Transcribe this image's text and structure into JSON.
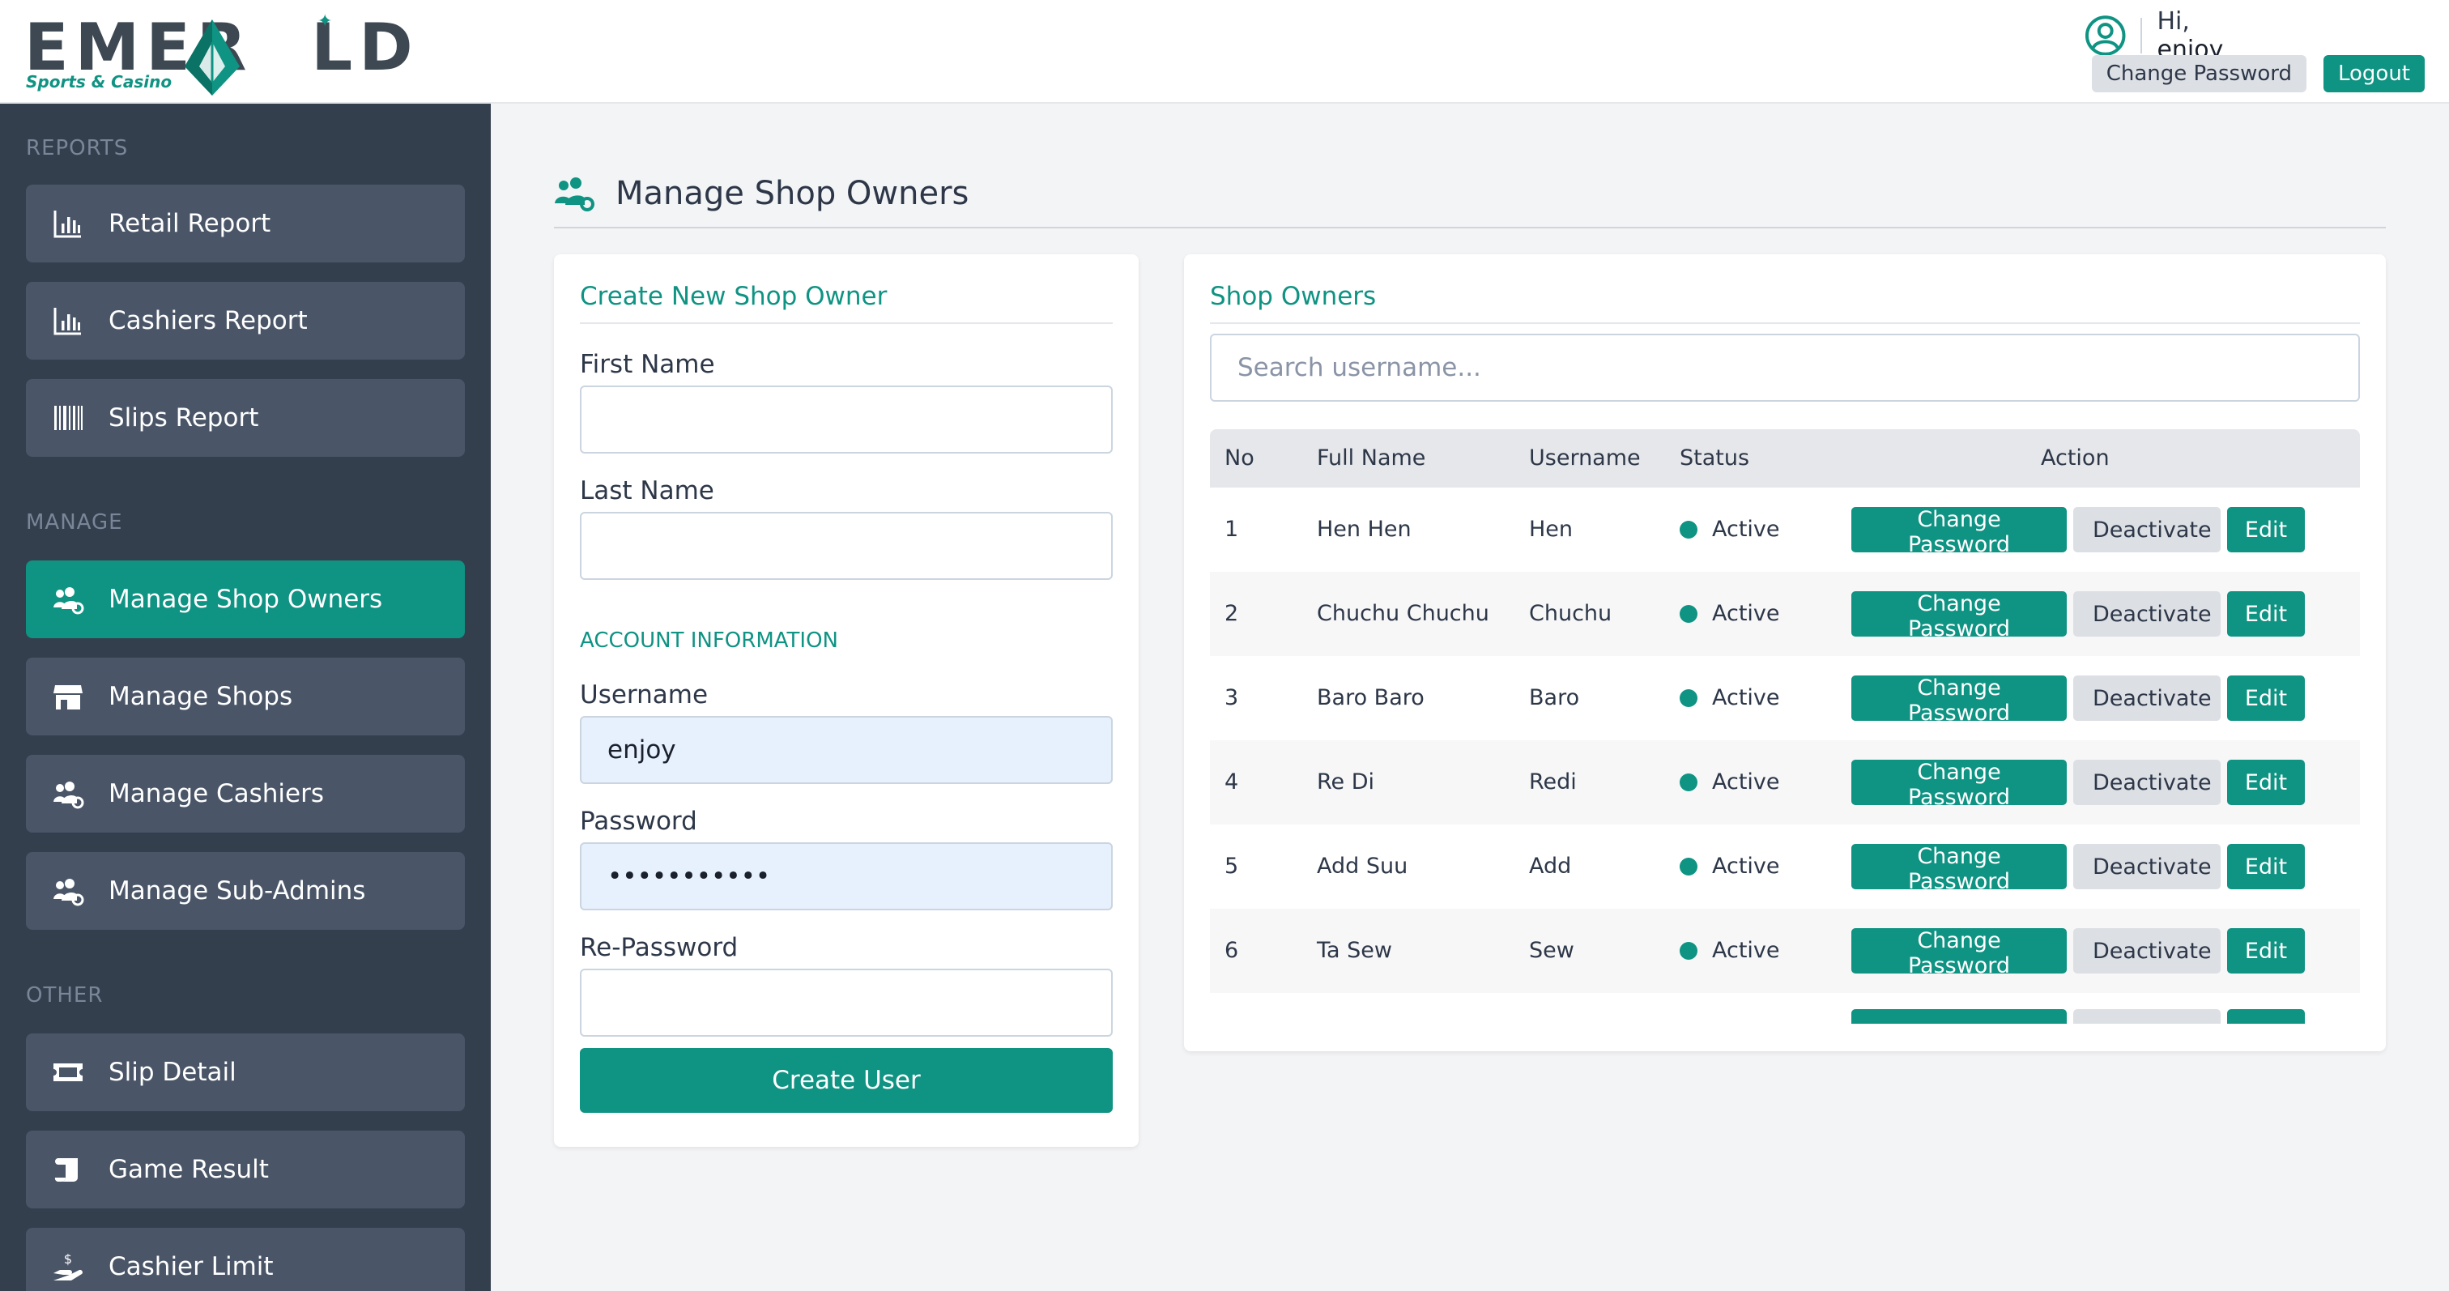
{
  "brand": {
    "name": "EMERALD",
    "tagline": "Sports & Casino",
    "accent": "#0f9383"
  },
  "header": {
    "greeting_prefix": "Hi,",
    "username": "enjoy",
    "change_password_label": "Change Password",
    "logout_label": "Logout"
  },
  "sidebar": {
    "sections": [
      {
        "title": "REPORTS",
        "items": [
          {
            "label": "Retail Report",
            "icon": "bar-chart-icon"
          },
          {
            "label": "Cashiers Report",
            "icon": "bar-chart-icon"
          },
          {
            "label": "Slips Report",
            "icon": "barcode-icon"
          }
        ]
      },
      {
        "title": "MANAGE",
        "items": [
          {
            "label": "Manage Shop Owners",
            "icon": "users-cog-icon",
            "active": true
          },
          {
            "label": "Manage Shops",
            "icon": "store-icon"
          },
          {
            "label": "Manage Cashiers",
            "icon": "users-cog-icon"
          },
          {
            "label": "Manage Sub-Admins",
            "icon": "users-cog-icon"
          }
        ]
      },
      {
        "title": "OTHER",
        "items": [
          {
            "label": "Slip Detail",
            "icon": "ticket-icon"
          },
          {
            "label": "Game Result",
            "icon": "scroll-icon"
          },
          {
            "label": "Cashier Limit",
            "icon": "hand-dollar-icon"
          }
        ]
      }
    ]
  },
  "page": {
    "title": "Manage Shop Owners"
  },
  "create_form": {
    "title": "Create New Shop Owner",
    "first_name_label": "First Name",
    "first_name_value": "",
    "last_name_label": "Last Name",
    "last_name_value": "",
    "account_info_title": "ACCOUNT INFORMATION",
    "username_label": "Username",
    "username_value": "enjoy",
    "password_label": "Password",
    "password_value": "•••••••••••",
    "repassword_label": "Re-Password",
    "repassword_value": "",
    "submit_label": "Create User"
  },
  "owners": {
    "title": "Shop Owners",
    "search_placeholder": "Search username...",
    "columns": {
      "no": "No",
      "full_name": "Full Name",
      "username": "Username",
      "status": "Status",
      "action": "Action"
    },
    "action_labels": {
      "change_password": "Change Password",
      "deactivate": "Deactivate",
      "edit": "Edit"
    },
    "rows": [
      {
        "no": "1",
        "full_name": "Hen Hen",
        "username": "Hen",
        "status": "Active"
      },
      {
        "no": "2",
        "full_name": "Chuchu Chuchu",
        "username": "Chuchu",
        "status": "Active"
      },
      {
        "no": "3",
        "full_name": "Baro Baro",
        "username": "Baro",
        "status": "Active"
      },
      {
        "no": "4",
        "full_name": "Re Di",
        "username": "Redi",
        "status": "Active"
      },
      {
        "no": "5",
        "full_name": "Add Suu",
        "username": "Add",
        "status": "Active"
      },
      {
        "no": "6",
        "full_name": "Ta Sew",
        "username": "Sew",
        "status": "Active"
      }
    ]
  }
}
